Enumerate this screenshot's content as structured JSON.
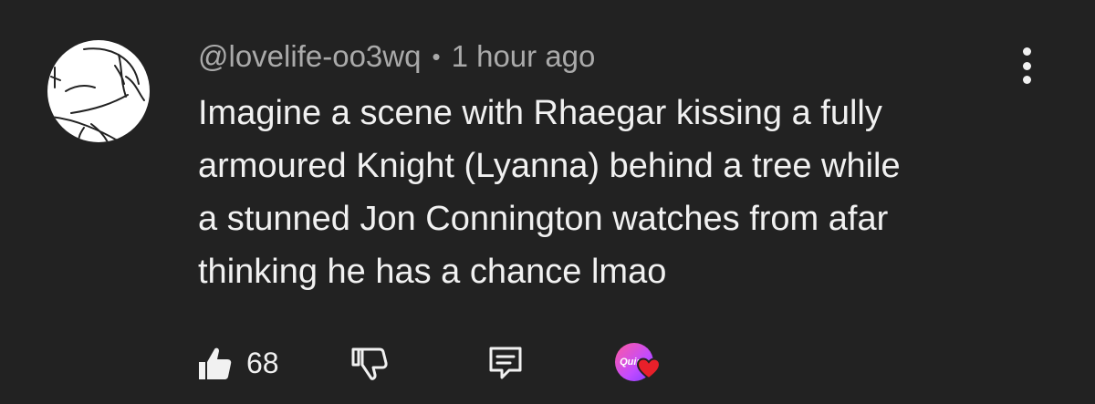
{
  "comment": {
    "author": "@lovelife-oo3wq",
    "separator": "•",
    "time": "1 hour ago",
    "text_lines": [
      "Imagine a scene with Rhaegar kissing a fully",
      "armoured Knight (Lyanna) behind a tree while",
      "a stunned Jon Connington watches from afar",
      "thinking he has a chance lmao"
    ]
  },
  "actions": {
    "like_count": "68",
    "creator_badge_text": "Quinn"
  },
  "icons": {
    "like": "thumbs-up-icon",
    "dislike": "thumbs-down-icon",
    "reply": "reply-comment-icon",
    "more": "more-vertical-icon",
    "heart": "heart-icon"
  },
  "colors": {
    "background": "#222222",
    "text": "#f1f1f1",
    "meta": "#aaaaaa",
    "heart": "#e8202a"
  }
}
